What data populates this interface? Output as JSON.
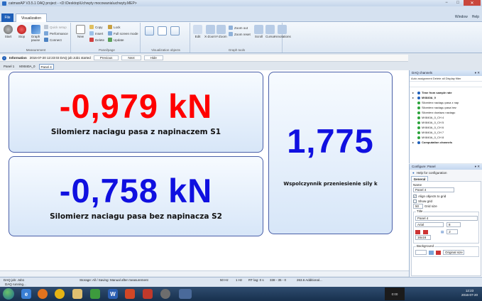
{
  "window": {
    "title": "catmanAP V3.5.1 DAQ project - <D:\\Desktop\\Uchwyty mocowania\\uchwyty.MEP>",
    "controls": [
      "−",
      "□",
      "✕"
    ]
  },
  "ribbon": {
    "file_tab": "File",
    "active_tab": "Visualization",
    "right_links": [
      "Window",
      "Help"
    ],
    "groups": [
      {
        "label": "Measurement",
        "buttons": [
          "Start",
          "Stop",
          "Graph pause",
          "Quick setup",
          "Performance",
          "Connect"
        ]
      },
      {
        "label": "Panel/page",
        "buttons": [
          "New",
          "Copy",
          "Insert",
          "Delete",
          "Lock",
          "Full screen mode",
          "Update"
        ]
      },
      {
        "label": "Visualization objects",
        "buttons": []
      },
      {
        "label": "Graph tools",
        "buttons": [
          "Edit",
          "X-Zoom",
          "Y-Zoom",
          "Zoom out",
          "Zoom reset",
          "Scroll",
          "Cursor",
          "Annotations"
        ]
      }
    ]
  },
  "infobar": {
    "label": "Information",
    "message": "2016-07-20 12:23:03 DAQ job Job1 started",
    "buttons": [
      "Previous",
      "Next",
      "Hide"
    ]
  },
  "panel_tabs": [
    "Panel 1",
    "MX840A_0",
    "Panel 4"
  ],
  "tiles": {
    "top_value": "-0,979 kN",
    "top_label": "Silomierz naciagu pasa z napinaczem S1",
    "bottom_value": "-0,758 kN",
    "bottom_label": "Silomierz naciagu pasa bez napinacza S2",
    "right_value": "1,775",
    "right_label": "Wspolczynnik przeniesienie sily k",
    "colors": {
      "top": "#ff0000",
      "bottom": "#1010e0",
      "right": "#1010e0"
    }
  },
  "daq_channels": {
    "title": "DAQ channels",
    "tools": "Auto assignment  Delete all  Display filter",
    "rows": [
      {
        "text": "Time from sample rate",
        "bold": true
      },
      {
        "text": "MX840A_0",
        "bold": true
      },
      {
        "text": "Silomierz naciagu pasa z nap",
        "bold": false
      },
      {
        "text": "Silomierz naciagu pasa bez",
        "bold": false
      },
      {
        "text": "Silomierz dowiazu naciagu",
        "bold": false
      },
      {
        "text": "MX840A_0_CH 4",
        "bold": false
      },
      {
        "text": "MX840A_0_CH 5",
        "bold": false
      },
      {
        "text": "MX840A_0_CH 6",
        "bold": false
      },
      {
        "text": "MX840A_0_CH 7",
        "bold": false
      },
      {
        "text": "MX840A_0_CH 8",
        "bold": false
      },
      {
        "text": "Computation channels",
        "bold": true
      }
    ]
  },
  "configure": {
    "title": "Configure: Panel",
    "help": "Help for configuration",
    "tab": "General",
    "name_label": "Name",
    "name_value": "Panel 4",
    "align_label": "Align objects to grid",
    "show_grid_label": "Show grid",
    "grid_size_value": "50",
    "grid_size_label": "Grid size",
    "title_group": "Title",
    "title_value": "Panel 4",
    "font_value": "Arial",
    "font_size": "8",
    "spacing": "2",
    "dims": "16x16",
    "background_group": "Background",
    "background_value": "Original size"
  },
  "status": {
    "left": "DAQ job: Job1",
    "storage": "Storage: All / Saving: Manual after measurement",
    "rate": "50 Hz",
    "hz": "1 Hz",
    "rt": "RT lag: 0 s",
    "mem": "338 - 35 - 0",
    "disk": "263.6 Additional...",
    "running": "DAQ running..."
  },
  "taskbar": {
    "time": "12:23",
    "date": "2016-07-20",
    "counter": "0:00"
  }
}
